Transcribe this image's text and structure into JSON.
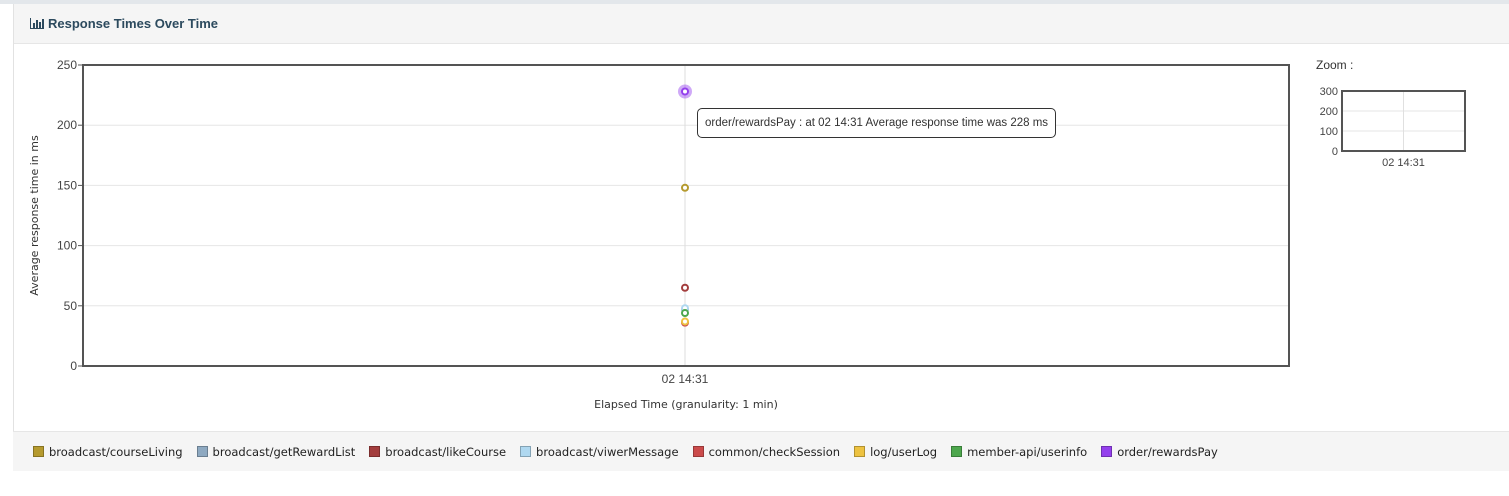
{
  "panel": {
    "title": "Response Times Over Time"
  },
  "tooltip": {
    "text": "order/rewardsPay : at 02 14:31 Average response time was 228 ms"
  },
  "zoom": {
    "label": "Zoom :",
    "yticks": [
      0,
      100,
      200,
      300
    ],
    "ylim": [
      0,
      300
    ]
  },
  "chart_data": {
    "type": "line",
    "xlabel": "Elapsed Time (granularity: 1 min)",
    "ylabel": "Average response time in ms",
    "ylim": [
      0,
      250
    ],
    "yticks": [
      0,
      50,
      100,
      150,
      200,
      250
    ],
    "x": [
      "02 14:31"
    ],
    "grid": true,
    "legend_position": "bottom",
    "highlighted_series": "order/rewardsPay",
    "series": [
      {
        "name": "broadcast/courseLiving",
        "color": "#b59a2e",
        "values": [
          148
        ]
      },
      {
        "name": "broadcast/getRewardList",
        "color": "#8ea9c1",
        "values": [
          47
        ]
      },
      {
        "name": "broadcast/likeCourse",
        "color": "#a33d3d",
        "values": [
          65
        ]
      },
      {
        "name": "broadcast/viwerMessage",
        "color": "#afd8f0",
        "values": [
          48
        ]
      },
      {
        "name": "common/checkSession",
        "color": "#cb4b4b",
        "values": [
          36
        ]
      },
      {
        "name": "log/userLog",
        "color": "#edc240",
        "values": [
          37
        ]
      },
      {
        "name": "member-api/userinfo",
        "color": "#4da74d",
        "values": [
          44
        ]
      },
      {
        "name": "order/rewardsPay",
        "color": "#9440ed",
        "values": [
          228
        ]
      }
    ]
  }
}
